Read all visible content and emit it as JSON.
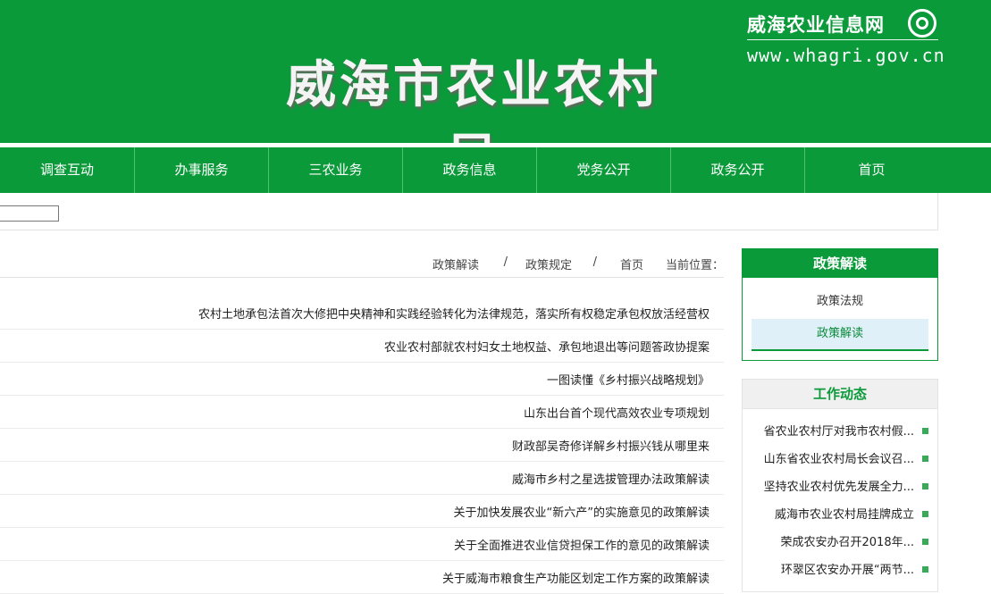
{
  "banner": {
    "title": "威海市农业农村局",
    "site_name": "威海农业信息网",
    "site_url": "www.whagri.gov.cn",
    "logo_icon": "globe-logo-icon"
  },
  "nav": {
    "items": [
      {
        "label": "首页"
      },
      {
        "label": "政务公开"
      },
      {
        "label": "党务公开"
      },
      {
        "label": "政务信息"
      },
      {
        "label": "三农业务"
      },
      {
        "label": "办事服务"
      },
      {
        "label": "调查互动"
      }
    ]
  },
  "search": {
    "value": ""
  },
  "breadcrumb": {
    "prefix": "当前位置：",
    "home": "首页",
    "sep": "/",
    "level1": "政策规定",
    "level2": "政策解读"
  },
  "articles": [
    {
      "title": "农村土地承包法首次大修把中央精神和实践经验转化为法律规范，落实所有权稳定承包权放活经营权"
    },
    {
      "title": "农业农村部就农村妇女土地权益、承包地退出等问题答政协提案"
    },
    {
      "title": "一图读懂《乡村振兴战略规划》"
    },
    {
      "title": "山东出台首个现代高效农业专项规划"
    },
    {
      "title": "财政部吴奇修详解乡村振兴钱从哪里来"
    },
    {
      "title": "威海市乡村之星选拔管理办法政策解读"
    },
    {
      "title": "关于加快发展农业“新六产”的实施意见的政策解读"
    },
    {
      "title": "关于全面推进农业信贷担保工作的意见的政策解读"
    },
    {
      "title": "关于威海市粮食生产功能区划定工作方案的政策解读"
    }
  ],
  "sidebar": {
    "policy_box": {
      "title": "政策解读",
      "links": [
        {
          "label": "政策法规"
        },
        {
          "label": "政策解读"
        }
      ]
    },
    "news_box": {
      "title": "工作动态",
      "items": [
        {
          "label": "省农业农村厅对我市农村假..."
        },
        {
          "label": "山东省农业农村局长会议召..."
        },
        {
          "label": "坚持农业农村优先发展全力..."
        },
        {
          "label": "威海市农业农村局挂牌成立"
        },
        {
          "label": "荣成农安办召开2018年..."
        },
        {
          "label": "环翠区农安办开展“两节..."
        }
      ]
    }
  },
  "colors": {
    "brand": "#0a9a3a",
    "active_bg": "#dff0f8"
  }
}
